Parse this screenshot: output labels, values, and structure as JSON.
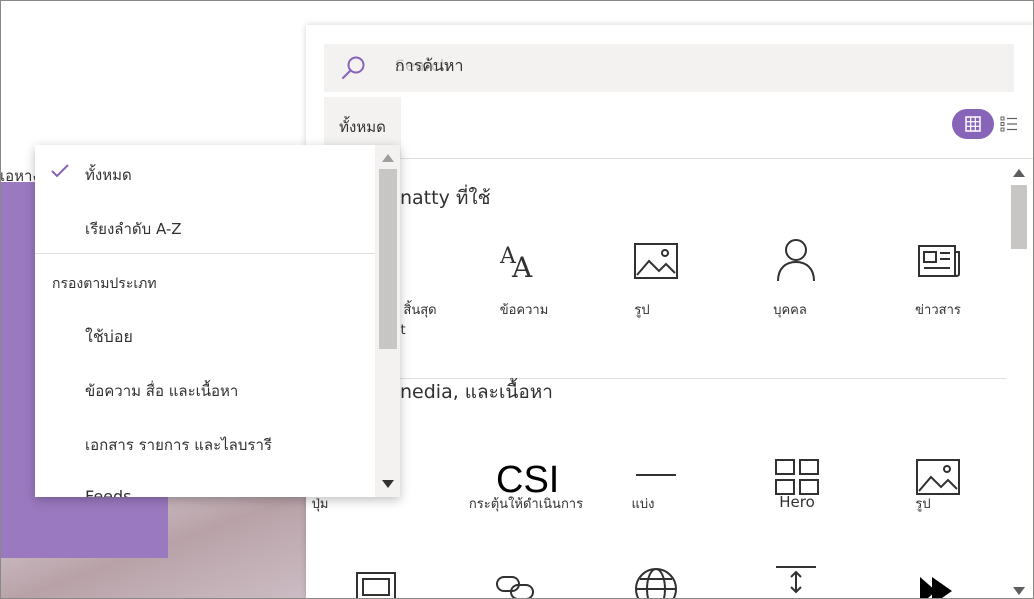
{
  "background": {
    "partial_text": "เอหาง"
  },
  "toolbox": {
    "search": {
      "placeholder": "Search",
      "value": "การค้นหา"
    },
    "filter_label": "ทั้งหมด",
    "view": {
      "grid_icon": "grid-icon",
      "list_icon": "list-icon"
    },
    "sections": [
      {
        "title": "natty ที่ใช้",
        "partial_label_1": "สิ้นสุด",
        "partial_label_2": "t",
        "tiles": [
          {
            "label": "ข้อความ",
            "icon": "text-icon"
          },
          {
            "label": "รูป",
            "icon": "image-icon"
          },
          {
            "label": "บุคคล",
            "icon": "person-icon"
          },
          {
            "label": "ข่าวสาร",
            "icon": "news-icon"
          }
        ]
      },
      {
        "title": "nedia, และเนื้อหา",
        "partial_label": "ปุ่ม",
        "tiles": [
          {
            "label": "กระตุ้นให้ดำเนินการ",
            "glyph": "CSI",
            "icon": "call-to-action-icon"
          },
          {
            "label": "แบ่ง",
            "icon": "divider-icon"
          },
          {
            "label": "Hero",
            "icon": "hero-icon"
          },
          {
            "label": "รูป",
            "icon": "image-icon"
          }
        ]
      }
    ]
  },
  "dropdown": {
    "items_top": [
      {
        "label": "ทั้งหมด",
        "checked": true
      },
      {
        "label": "เรียงลำดับ A-Z",
        "checked": false
      }
    ],
    "group_header": "กรองตามประเภท",
    "group_items": [
      {
        "label": "ใช้บ่อย"
      },
      {
        "label": "ข้อความ สื่อ และเนื้อหา"
      },
      {
        "label": "เอกสาร รายการ และไลบรารี"
      },
      {
        "label": "Feeds"
      }
    ]
  },
  "colors": {
    "accent": "#8764b8",
    "hero_purple": "#9b79c0"
  }
}
